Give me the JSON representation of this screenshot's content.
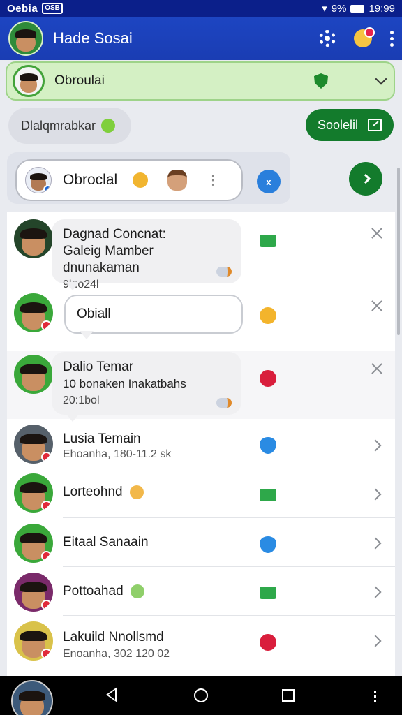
{
  "status_bar": {
    "carrier": "Oebia",
    "network": "OSB",
    "signal_text": "9%",
    "time": "19:99"
  },
  "app_bar": {
    "title": "Hade Sosai"
  },
  "group_bar": {
    "name": "Obroulai"
  },
  "search_pill": {
    "label": "Dlalqmrabkar"
  },
  "primary_button": {
    "label": "Soolelil"
  },
  "composer": {
    "text": "Obroclal",
    "translate_label": "x"
  },
  "conversations": [
    {
      "title": "Dagnad Concnat:",
      "subtitle": "Galeig Mamber dnunakaman",
      "time": "9k:o24l"
    },
    {
      "title": "Obiall",
      "subtitle": "",
      "time": ""
    },
    {
      "title": "Dalio Temar",
      "subtitle": "10 bonaken Inakatbahs",
      "time": "20:1bol"
    },
    {
      "title": "Lusia Temain",
      "subtitle": "Ehoanha, 180-11.2 sk",
      "time": ""
    },
    {
      "title": "Lorteohnd",
      "subtitle": "",
      "time": ""
    },
    {
      "title": "Eitaal Sanaain",
      "subtitle": "",
      "time": ""
    },
    {
      "title": "Pottoahad",
      "subtitle": "",
      "time": ""
    },
    {
      "title": "Lakuild Nnollsmd",
      "subtitle": "Enoanha, 302 120 02",
      "time": ""
    }
  ],
  "colors": {
    "brand": "#1d45c2",
    "accent_green": "#137b2c",
    "group_bg": "#d4f0c4"
  }
}
